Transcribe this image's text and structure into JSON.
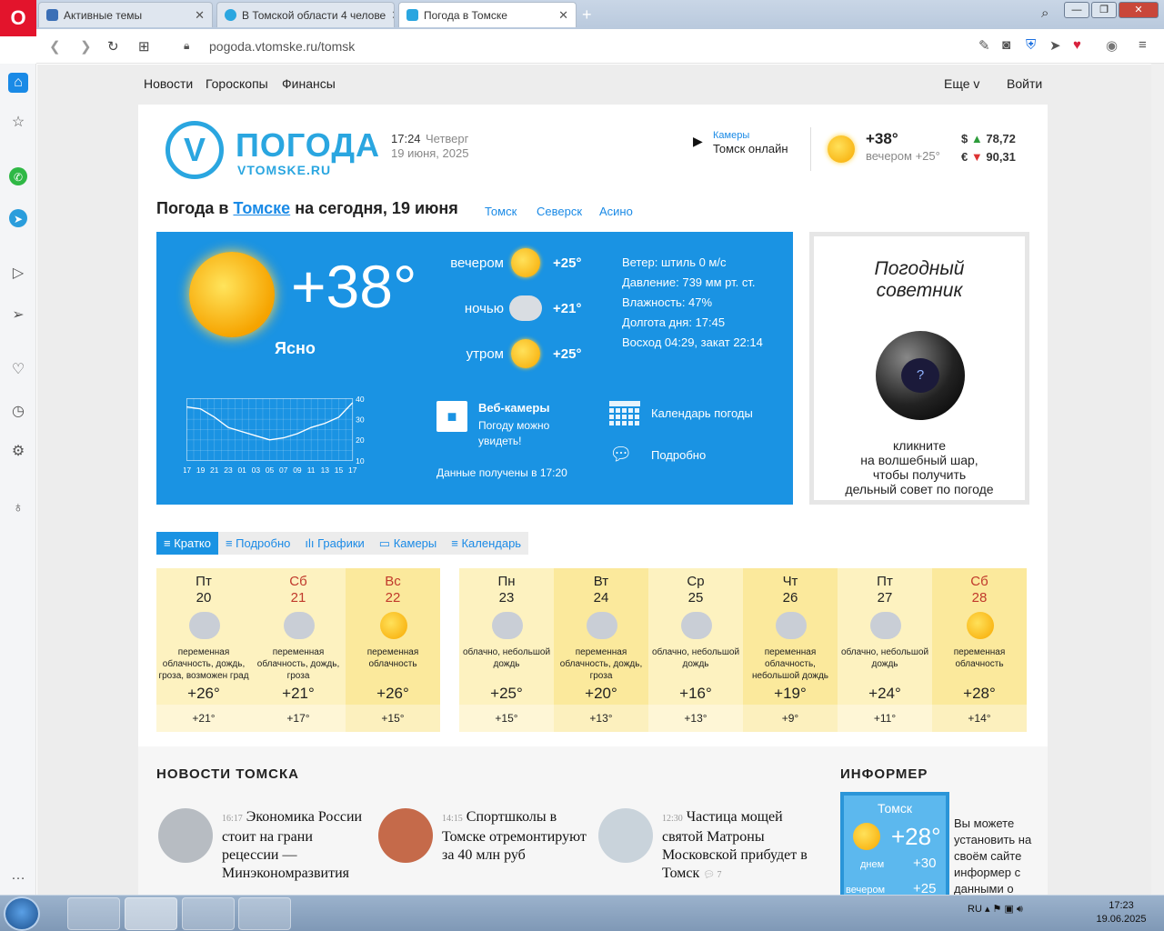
{
  "browser": {
    "tabs": [
      {
        "title": "Активные темы"
      },
      {
        "title": "В Томской области 4 челове"
      },
      {
        "title": "Погода в Томске"
      }
    ],
    "url": "pogoda.vtomske.ru/tomsk"
  },
  "topnav": {
    "items": [
      "Новости",
      "Гороскопы",
      "Финансы"
    ],
    "more": "Еще v",
    "login": "Войти"
  },
  "header": {
    "logo_letter": "V",
    "logo_title": "ПОГОДА",
    "logo_sub": "VTOMSKE.RU",
    "time": "17:24",
    "weekday": "Четверг",
    "date": "19 июня, 2025",
    "cameras_label": "Камеры",
    "cameras_text": "Томск онлайн",
    "temp": "+38°",
    "evening": "вечером +25°",
    "usd_sign": "$",
    "usd": "78,72",
    "eur_sign": "€",
    "eur": "90,31"
  },
  "title": {
    "prefix": "Погода в ",
    "city": "Томске",
    "suffix": " на сегодня, 19 июня",
    "cities": [
      "Томск",
      "Северск",
      "Асино"
    ]
  },
  "now": {
    "temp": "+38°",
    "condition": "Ясно",
    "parts": [
      {
        "label": "вечером",
        "temp": "+25°"
      },
      {
        "label": "ночью",
        "temp": "+21°"
      },
      {
        "label": "утром",
        "temp": "+25°"
      }
    ],
    "details": [
      "Ветер: штиль 0 м/с",
      "Давление: 739 мм рт. ст.",
      "Влажность: 47%",
      "Долгота дня: 17:45",
      "Восход 04:29, закат 22:14"
    ],
    "webcams_title": "Веб-камеры",
    "webcams_sub1": "Погоду можно",
    "webcams_sub2": "увидеть!",
    "calendar": "Календарь погоды",
    "detailed": "Подробно",
    "received": "Данные получены в 17:20"
  },
  "chart_data": {
    "type": "line",
    "x": [
      "17",
      "19",
      "21",
      "23",
      "01",
      "03",
      "05",
      "07",
      "09",
      "11",
      "13",
      "15",
      "17"
    ],
    "values": [
      36,
      35,
      31,
      26,
      24,
      22,
      20,
      21,
      23,
      26,
      28,
      31,
      38
    ],
    "yticks": [
      "40",
      "30",
      "20",
      "10"
    ],
    "ylim": [
      10,
      40
    ],
    "grid": true
  },
  "advisor": {
    "title1": "Погодный",
    "title2": "советник",
    "ball_mark": "?",
    "text1": "кликните",
    "text2": "на волшебный шар,",
    "text3": "чтобы получить",
    "text4": "дельный совет по погоде"
  },
  "tabs": [
    "Кратко",
    "Подробно",
    "Графики",
    "Камеры",
    "Календарь"
  ],
  "forecast": [
    {
      "wd": "Пт",
      "d": "20",
      "desc": "переменная облачность, дождь, гроза, возможен град",
      "hi": "+26°",
      "lo": "+21°",
      "weekend": false,
      "icon": "cloud-rain"
    },
    {
      "wd": "Сб",
      "d": "21",
      "desc": "переменная облачность, дождь, гроза",
      "hi": "+21°",
      "lo": "+17°",
      "weekend": true,
      "icon": "cloud-rain"
    },
    {
      "wd": "Вс",
      "d": "22",
      "desc": "переменная облачность",
      "hi": "+26°",
      "lo": "+15°",
      "weekend": true,
      "icon": "sun-cloud"
    },
    {
      "wd": "Пн",
      "d": "23",
      "desc": "облачно, небольшой дождь",
      "hi": "+25°",
      "lo": "+15°",
      "weekend": false,
      "icon": "cloud-rain"
    },
    {
      "wd": "Вт",
      "d": "24",
      "desc": "переменная облачность, дождь, гроза",
      "hi": "+20°",
      "lo": "+13°",
      "weekend": false,
      "icon": "cloud-rain"
    },
    {
      "wd": "Ср",
      "d": "25",
      "desc": "облачно, небольшой дождь",
      "hi": "+16°",
      "lo": "+13°",
      "weekend": false,
      "icon": "cloud-rain"
    },
    {
      "wd": "Чт",
      "d": "26",
      "desc": "переменная облачность, небольшой дождь",
      "hi": "+19°",
      "lo": "+9°",
      "weekend": false,
      "icon": "cloud-rain"
    },
    {
      "wd": "Пт",
      "d": "27",
      "desc": "облачно, небольшой дождь",
      "hi": "+24°",
      "lo": "+11°",
      "weekend": false,
      "icon": "cloud-rain"
    },
    {
      "wd": "Сб",
      "d": "28",
      "desc": "переменная облачность",
      "hi": "+28°",
      "lo": "+14°",
      "weekend": true,
      "icon": "sun-cloud"
    }
  ],
  "news": {
    "heading": "НОВОСТИ ТОМСКА",
    "items": [
      {
        "time": "16:17",
        "text": "Экономика России стоит на грани рецессии — Минэкономразвития"
      },
      {
        "time": "14:15",
        "text": "Спортшколы в Томске отремонтируют за 40 млн руб"
      },
      {
        "time": "12:30",
        "text": "Частица мощей святой Матроны Московской прибудет в Томск",
        "comments": "7"
      }
    ]
  },
  "informer": {
    "heading": "ИНФОРМЕР",
    "city": "Томск",
    "temp": "+28°",
    "day_label": "днем",
    "day_temp": "+30",
    "eve_label": "вечером",
    "eve_temp": "+25",
    "desc": "Вы можете установить на своём сайте информер с данными о"
  },
  "taskbar": {
    "lang": "RU",
    "time": "17:23",
    "date": "19.06.2025"
  }
}
